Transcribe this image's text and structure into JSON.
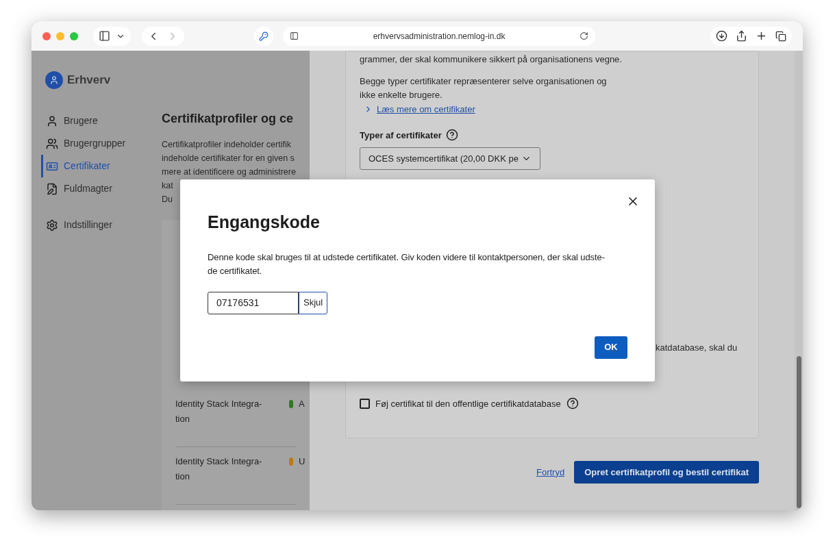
{
  "browser": {
    "url": "erhvervsadministration.nemlog-in.dk"
  },
  "app": {
    "name": "Erhverv"
  },
  "nav": [
    {
      "label": "Brugere",
      "kind": "user",
      "selected": false
    },
    {
      "label": "Brugergrupper",
      "kind": "group",
      "selected": false
    },
    {
      "label": "Certifikater",
      "kind": "certificate",
      "selected": true
    },
    {
      "label": "Fuldmagter",
      "kind": "document",
      "selected": false
    },
    {
      "label": "Indstillinger",
      "kind": "settings",
      "selected": false
    }
  ],
  "page": {
    "title": "Certifikatprofiler og ce",
    "intro_lines": [
      "Certifikatprofiler indeholder certifik",
      "indeholde certifikater for en given s",
      "mere at identificere og administrere",
      "kat",
      "Du"
    ],
    "rows": [
      {
        "name": "Identity Stack Integra-\ntion",
        "status": "A",
        "color": "#2f7a1f"
      },
      {
        "name": "Identity Stack Integra-\ntion",
        "status": "U",
        "color": "#c07a10"
      }
    ]
  },
  "drawer": {
    "top_text": "grammer, der skal kommunikere sikkert på organisationens vegne.",
    "text": "Begge typer certifikater repræsenterer selve organisationen og\nikke enkelte brugere.",
    "link": "Læs mere om certifikater",
    "types_label": "Typer af certifikater",
    "select_value": "OCES systemcertifikat (20,00 DKK pe",
    "partial_text": "katdatabase, skal du",
    "checkbox": {
      "label": "Føj certifikat til den offentlige certifikatdatabase",
      "checked": false
    },
    "cancel": "Fortryd",
    "submit": "Opret certifikatprofil og bestil certifikat"
  },
  "dialog": {
    "title": "Engangskode",
    "text": "Denne kode skal bruges til at udstede certifikatet. Giv koden videre til kontaktpersonen, der skal udste-\nde certifikatet.",
    "code": "07176531",
    "toggle": "Skjul",
    "ok": "OK"
  }
}
